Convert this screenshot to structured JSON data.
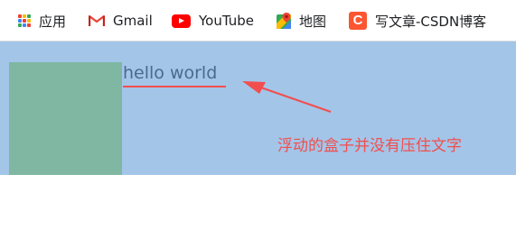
{
  "bookmarks": [
    {
      "label": "应用",
      "icon": "apps-grid-icon"
    },
    {
      "label": "Gmail",
      "icon": "gmail-icon"
    },
    {
      "label": "YouTube",
      "icon": "youtube-icon"
    },
    {
      "label": "地图",
      "icon": "maps-icon"
    },
    {
      "label": "写文章-CSDN博客",
      "icon": "csdn-icon",
      "icon_letter": "C"
    }
  ],
  "demo": {
    "text": "hello world",
    "annotation": "浮动的盒子并没有压住文字"
  },
  "colors": {
    "page_background": "#a3c5e8",
    "float_box": "#7fb7a2",
    "text": "#4a6a8e",
    "annotation": "#f24e4e",
    "arrow": "#f24e4e",
    "underline": "#f24e4e",
    "gmail_red": "#ea4335",
    "youtube_red": "#ff0000",
    "csdn_orange": "#fc5531"
  }
}
